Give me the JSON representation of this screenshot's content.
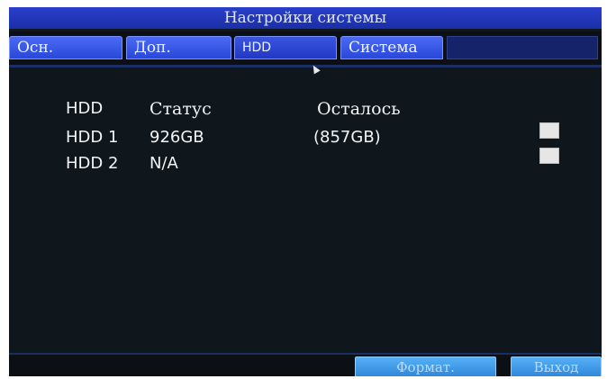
{
  "window": {
    "title": "Настройки системы"
  },
  "tabs": [
    {
      "label": "Осн."
    },
    {
      "label": "Доп."
    },
    {
      "label": "HDD"
    },
    {
      "label": "Система"
    }
  ],
  "table": {
    "headers": {
      "hdd": "HDD",
      "status": "Статус",
      "remaining": "Осталось"
    },
    "rows": [
      {
        "hdd": "HDD 1",
        "status": "926GB",
        "remaining": "(857GB)"
      },
      {
        "hdd": "HDD 2",
        "status": "N/A",
        "remaining": ""
      }
    ]
  },
  "buttons": {
    "format": "Формат.",
    "exit": "Выход"
  },
  "colors": {
    "titlebar": "#1b2fa8",
    "tab": "#2a47d8",
    "background": "#10171c",
    "button": "#2f86d8"
  }
}
